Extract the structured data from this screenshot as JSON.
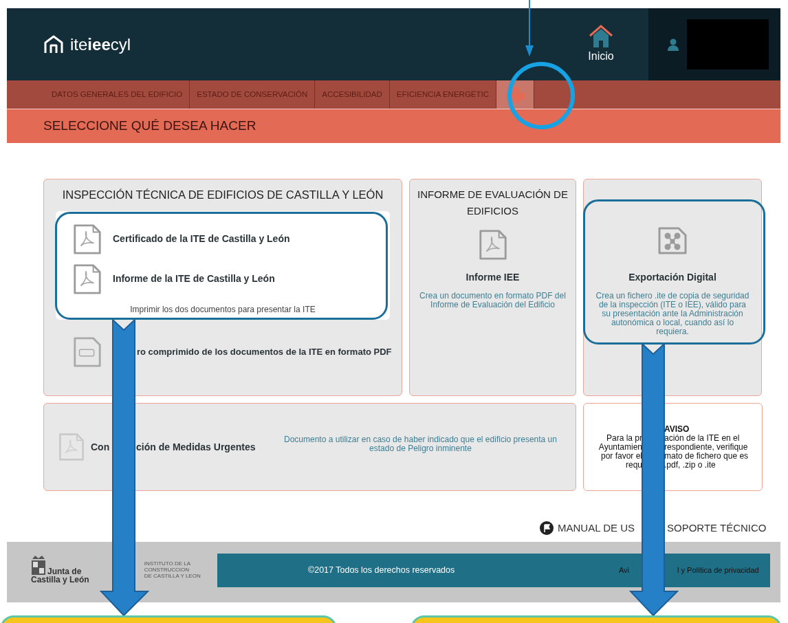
{
  "header": {
    "logo": "ite**iee**cyl",
    "home_label": "Inicio"
  },
  "tabs": [
    {
      "kind": "text",
      "label": "DATOS GENERALES DEL EDIFICIO",
      "selected": false
    },
    {
      "kind": "text",
      "label": "ESTADO DE CONSERVACIÓN",
      "selected": false
    },
    {
      "kind": "text",
      "label": "ACCESIBILIDAD",
      "selected": false
    },
    {
      "kind": "text",
      "label": "EFICIENCIA ENERGÉTIC",
      "selected": false
    },
    {
      "kind": "icon",
      "selected": true
    }
  ],
  "page_title": "SELECCIONE QUÉ DESEA HACER",
  "ite_card": {
    "title": "INSPECCIÓN TÉCNICA DE EDIFICIOS DE CASTILLA Y LEÓN",
    "documents": [
      {
        "label": "Certificado de la ITE de Castilla y León"
      },
      {
        "label": "Informe de la ITE de Castilla y León"
      }
    ],
    "note": "Imprimir los dos documentos para presentar la ITE",
    "zip_label": "ro comprimido de los documentos de la ITE en formato PDF"
  },
  "iee_card": {
    "title": "INFORME DE EVALUACIÓN DE EDIFICIOS",
    "label": "Informe IEE",
    "description": "Crea un documento en formato PDF del Informe de Evaluación del Edificio"
  },
  "export_card": {
    "label": "Exportación Digital",
    "description": "Crea un fichero .ite de copia de seguridad de la inspección (ITE o IEE), válido para su presentación ante la Administración autonómica o local, cuando así lo requiera."
  },
  "urgent_card": {
    "label_start": "Con",
    "label_end": "ción de Medidas Urgentes",
    "description": "Documento a utilizar en caso de haber indicado que el edificio presenta un estado de Peligro inminente"
  },
  "notice": {
    "title": "AVISO",
    "lines": [
      {
        "left": "Para la pr",
        "right": "ación de la ITE en el"
      },
      {
        "left": "Ayuntamien",
        "right": "respondiente, verifique"
      },
      {
        "left": "por favor el",
        "right": "mato de fichero que es"
      },
      {
        "left": "requ",
        "right": ".pdf, .zip o .ite"
      }
    ]
  },
  "links": {
    "manual": "MANUAL DE US",
    "support": "SOPORTE TÉCNICO"
  },
  "footer": {
    "junta_line1": "Junta de",
    "junta_line2": "Castilla y León",
    "institute": [
      "INSTITUTO DE LA",
      "CONSTRUCCION",
      "DE CASTILLA Y LEON"
    ],
    "copyright": "©2017 Todos los derechos reservados",
    "legal_start": "Avi",
    "legal_end": "l y Política de privacidad"
  }
}
